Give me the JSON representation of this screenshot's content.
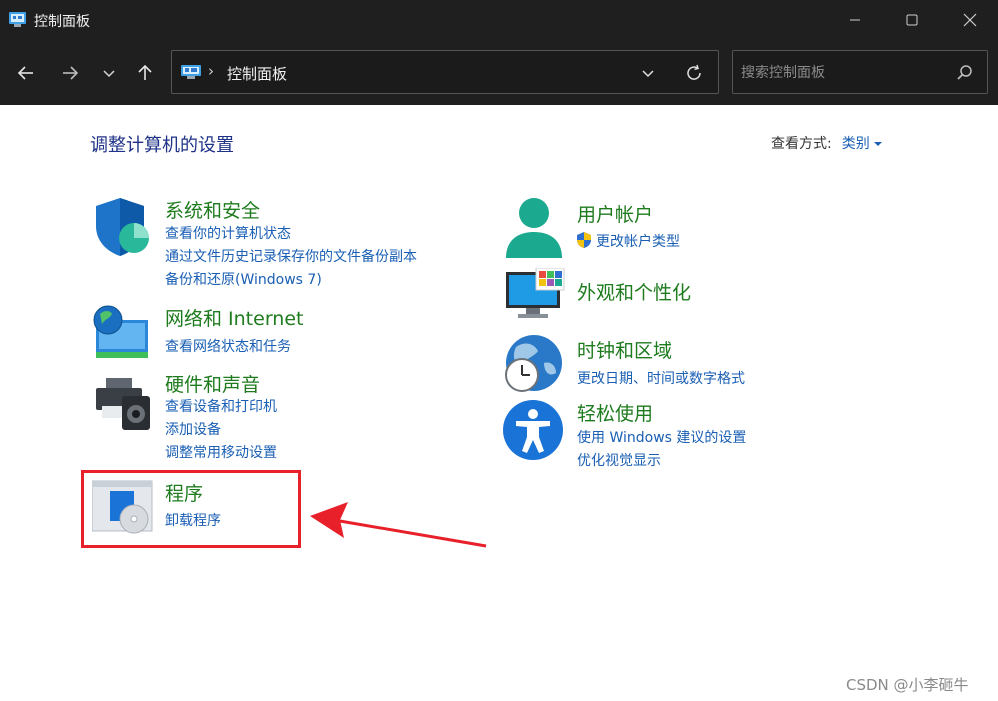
{
  "window": {
    "title": "控制面板"
  },
  "address": {
    "path": "控制面板",
    "separator": "›"
  },
  "search": {
    "placeholder": "搜索控制面板"
  },
  "content": {
    "heading": "调整计算机的设置",
    "view_by_label": "查看方式:",
    "view_by_value": "类别"
  },
  "categories": {
    "system": {
      "title": "系统和安全",
      "links": [
        "查看你的计算机状态",
        "通过文件历史记录保存你的文件备份副本",
        "备份和还原(Windows 7)"
      ]
    },
    "network": {
      "title": "网络和 Internet",
      "links": [
        "查看网络状态和任务"
      ]
    },
    "hardware": {
      "title": "硬件和声音",
      "links": [
        "查看设备和打印机",
        "添加设备",
        "调整常用移动设置"
      ]
    },
    "programs": {
      "title": "程序",
      "links": [
        "卸载程序"
      ]
    },
    "user": {
      "title": "用户帐户",
      "links": [
        "更改帐户类型"
      ]
    },
    "appearance": {
      "title": "外观和个性化",
      "links": []
    },
    "clock": {
      "title": "时钟和区域",
      "links": [
        "更改日期、时间或数字格式"
      ]
    },
    "ease": {
      "title": "轻松使用",
      "links": [
        "使用 Windows 建议的设置",
        "优化视觉显示"
      ]
    }
  },
  "watermark": "CSDN @小李砸牛",
  "colors": {
    "titlebar": "#1f1f1f",
    "category_title": "#1e7b1e",
    "link": "#1a5fb4",
    "heading": "#1e3287",
    "highlight": "#e8202a"
  }
}
